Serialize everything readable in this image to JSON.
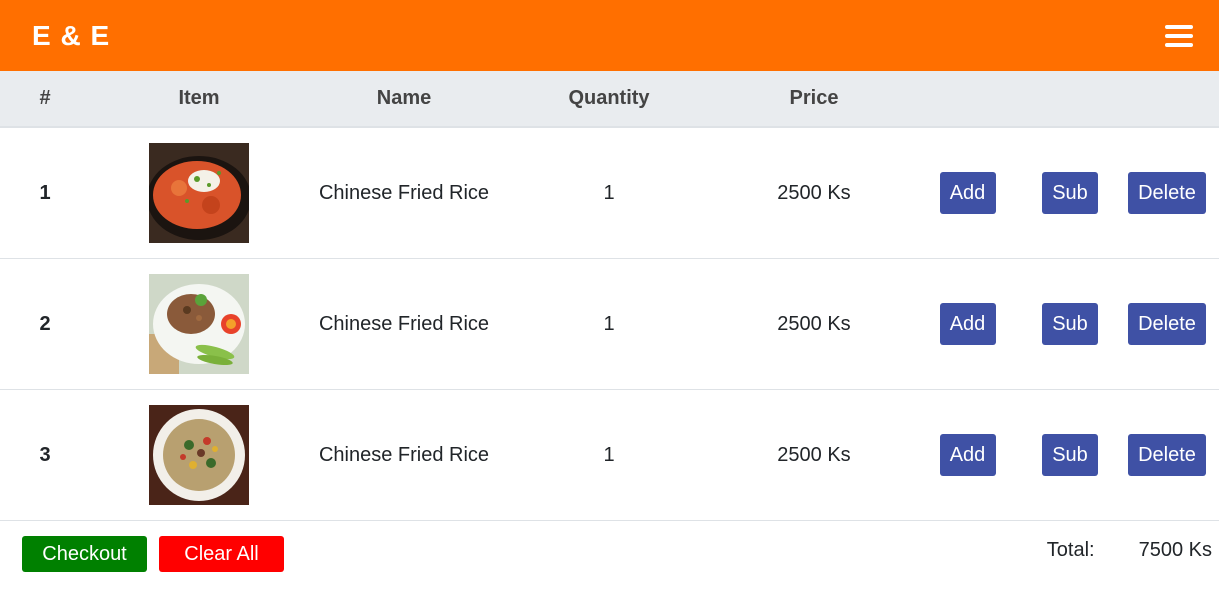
{
  "navbar": {
    "brand": "E & E",
    "menu_icon": "hamburger-icon"
  },
  "table": {
    "headers": [
      "#",
      "Item",
      "Name",
      "Quantity",
      "Price",
      "",
      "",
      ""
    ],
    "rows": [
      {
        "num": "1",
        "name": "Chinese Fried Rice",
        "qty": "1",
        "price": "2500 Ks",
        "add": "Add",
        "sub": "Sub",
        "delete": "Delete"
      },
      {
        "num": "2",
        "name": "Chinese Fried Rice",
        "qty": "1",
        "price": "2500 Ks",
        "add": "Add",
        "sub": "Sub",
        "delete": "Delete"
      },
      {
        "num": "3",
        "name": "Chinese Fried Rice",
        "qty": "1",
        "price": "2500 Ks",
        "add": "Add",
        "sub": "Sub",
        "delete": "Delete"
      }
    ]
  },
  "footer": {
    "checkout": "Checkout",
    "clear_all": "Clear All",
    "total_label": "Total:",
    "total_value": "7500 Ks"
  },
  "colors": {
    "navbar": "#ff6f00",
    "action_button": "#3f51a5",
    "checkout": "#008000",
    "clear": "#ff0000"
  }
}
